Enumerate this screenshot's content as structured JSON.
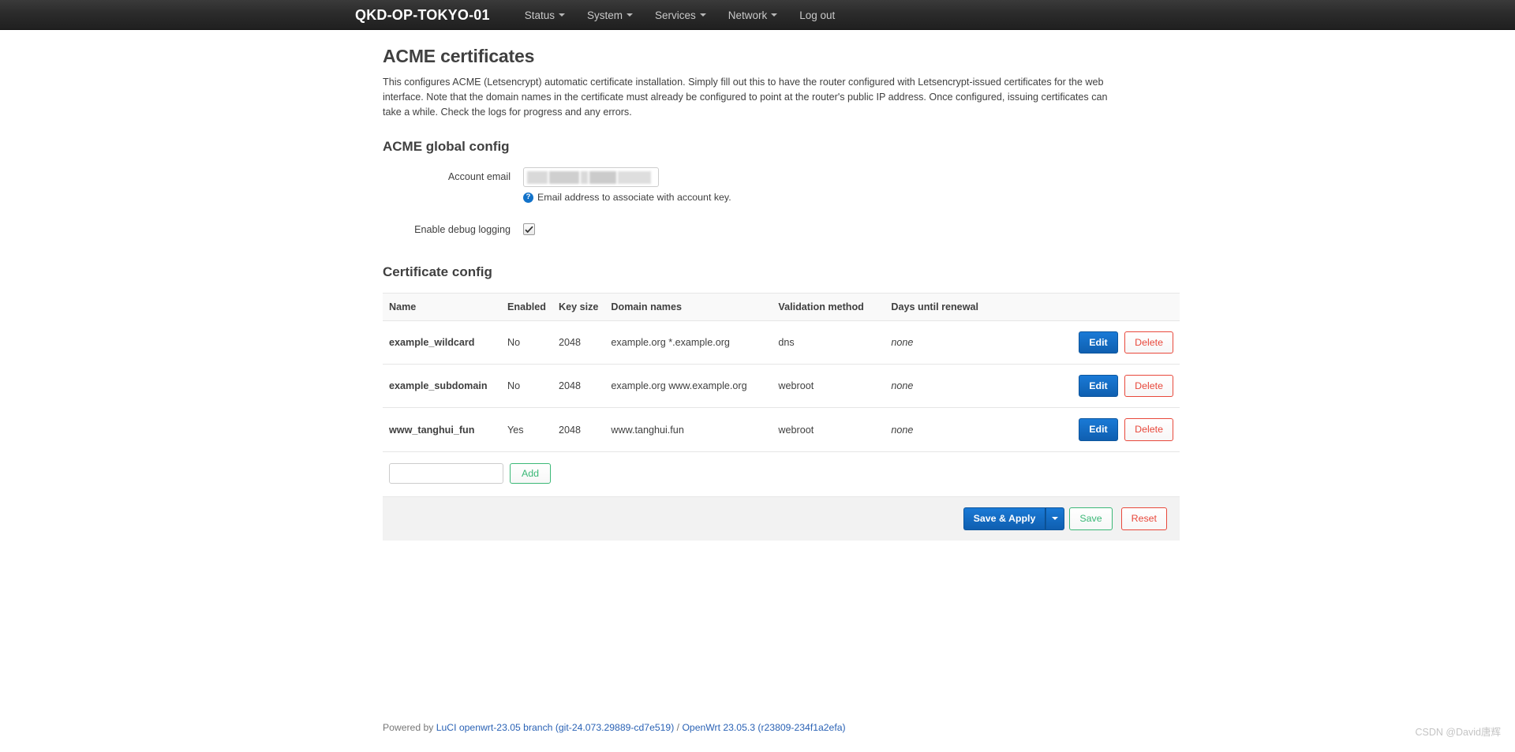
{
  "navbar": {
    "brand": "QKD-OP-TOKYO-01",
    "items": [
      {
        "label": "Status",
        "has_caret": true
      },
      {
        "label": "System",
        "has_caret": true
      },
      {
        "label": "Services",
        "has_caret": true
      },
      {
        "label": "Network",
        "has_caret": true
      },
      {
        "label": "Log out",
        "has_caret": false
      }
    ]
  },
  "page": {
    "title": "ACME certificates",
    "description": "This configures ACME (Letsencrypt) automatic certificate installation. Simply fill out this to have the router configured with Letsencrypt-issued certificates for the web interface. Note that the domain names in the certificate must already be configured to point at the router's public IP address. Once configured, issuing certificates can take a while. Check the logs for progress and any errors."
  },
  "global_config": {
    "title": "ACME global config",
    "account_email": {
      "label": "Account email",
      "value": "",
      "placeholder": "",
      "redacted": true,
      "hint": "Email address to associate with account key.",
      "help_icon": "question-mark-icon"
    },
    "debug_logging": {
      "label": "Enable debug logging",
      "checked": true,
      "check_icon": "check-icon"
    }
  },
  "certificate_config": {
    "title": "Certificate config",
    "columns": [
      "Name",
      "Enabled",
      "Key size",
      "Domain names",
      "Validation method",
      "Days until renewal",
      ""
    ],
    "rows": [
      {
        "name": "example_wildcard",
        "enabled": "No",
        "key_size": "2048",
        "domain_names": "example.org *.example.org",
        "validation_method": "dns",
        "days_until_renewal": "none",
        "edit_label": "Edit",
        "delete_label": "Delete"
      },
      {
        "name": "example_subdomain",
        "enabled": "No",
        "key_size": "2048",
        "domain_names": "example.org www.example.org",
        "validation_method": "webroot",
        "days_until_renewal": "none",
        "edit_label": "Edit",
        "delete_label": "Delete"
      },
      {
        "name": "www_tanghui_fun",
        "enabled": "Yes",
        "key_size": "2048",
        "domain_names": "www.tanghui.fun",
        "validation_method": "webroot",
        "days_until_renewal": "none",
        "edit_label": "Edit",
        "delete_label": "Delete"
      }
    ],
    "add": {
      "input_value": "",
      "input_placeholder": "",
      "button_label": "Add"
    }
  },
  "actions": {
    "save_apply_label": "Save & Apply",
    "dropdown_icon": "caret-down-icon",
    "save_label": "Save",
    "reset_label": "Reset"
  },
  "footer": {
    "powered_by": "Powered by",
    "luci_link": "LuCI openwrt-23.05 branch (git-24.073.29889-cd7e519)",
    "separator": "/",
    "openwrt_link": "OpenWrt 23.05.3 (r23809-234f1a2efa)"
  },
  "watermark": {
    "text": "CSDN @David唐辉"
  },
  "colors": {
    "navbar_bg": "#2b2b2b",
    "primary": "#1272c9",
    "danger": "#e8483b",
    "success": "#3bb877",
    "link": "#2a62b5"
  }
}
